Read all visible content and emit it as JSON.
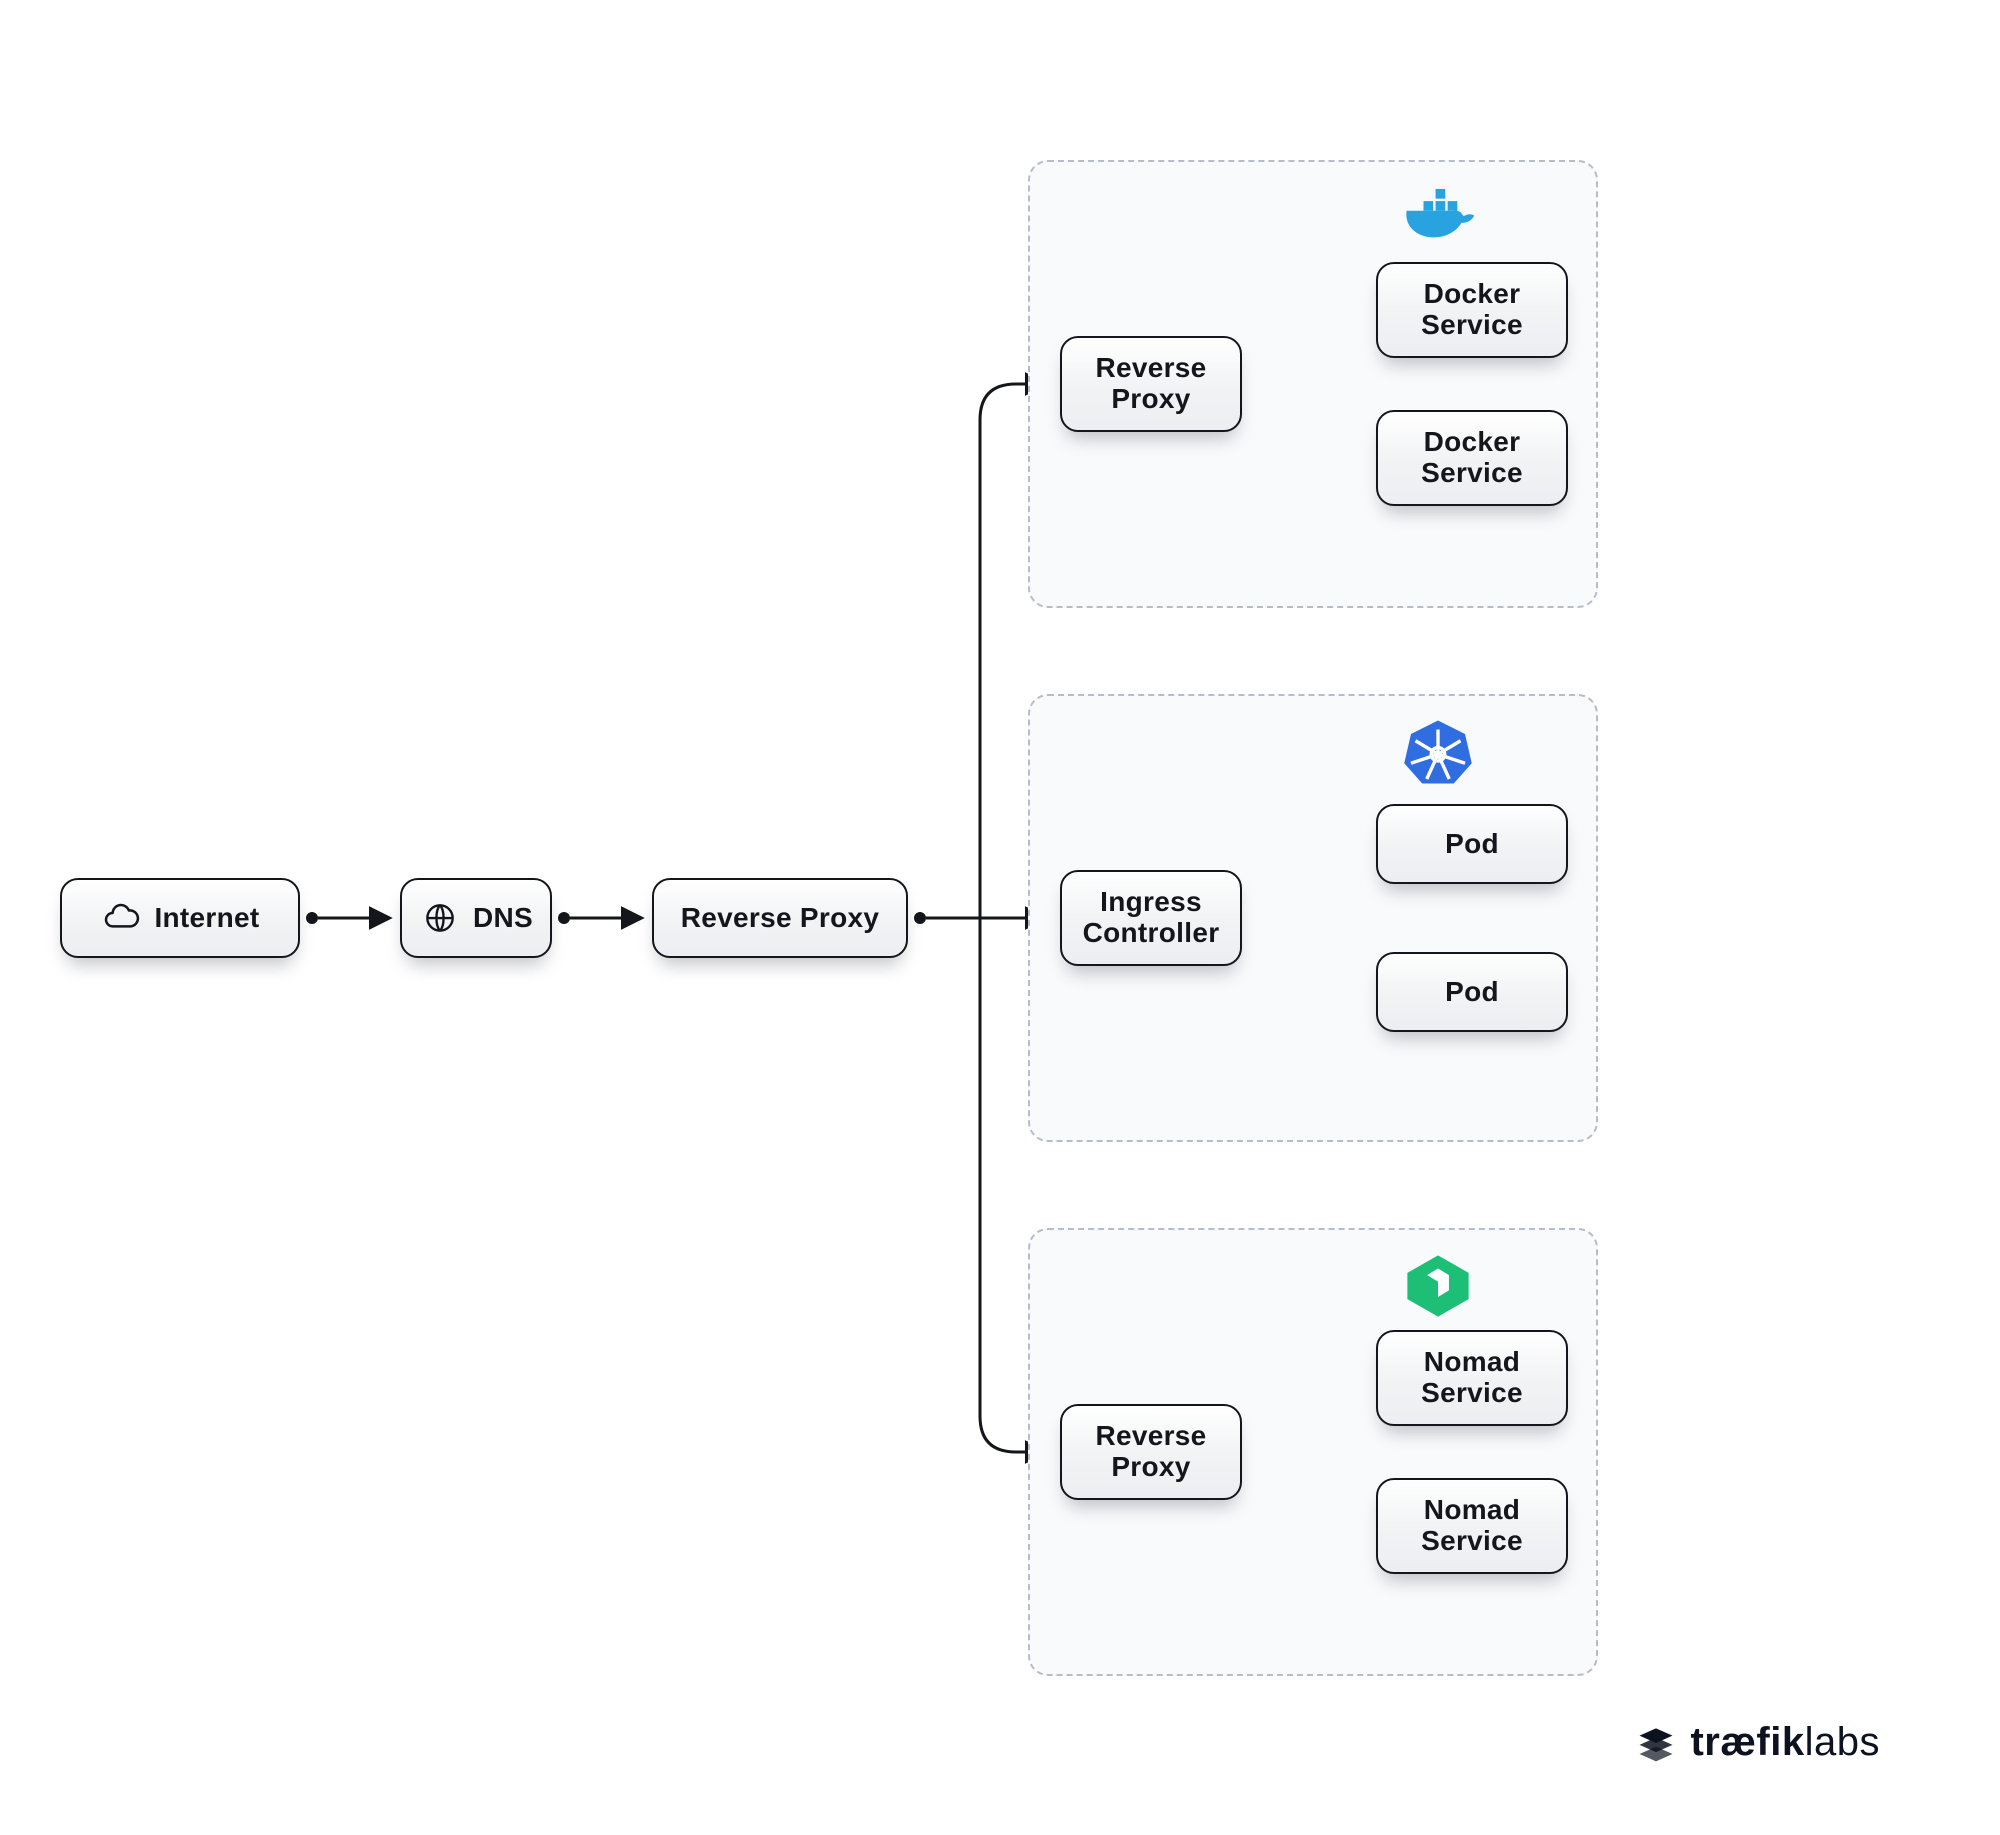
{
  "nodes": {
    "internet": "Internet",
    "dns": "DNS",
    "reverse_proxy_main": "Reverse Proxy",
    "cluster_docker": {
      "proxy": "Reverse\nProxy",
      "svc1": "Docker\nService",
      "svc2": "Docker\nService"
    },
    "cluster_k8s": {
      "proxy": "Ingress\nController",
      "svc1": "Pod",
      "svc2": "Pod"
    },
    "cluster_nomad": {
      "proxy": "Reverse\nProxy",
      "svc1": "Nomad\nService",
      "svc2": "Nomad\nService"
    }
  },
  "icons": {
    "internet": "cloud-icon",
    "dns": "globe-icon",
    "docker": "docker-icon",
    "kubernetes": "kubernetes-icon",
    "nomad": "nomad-icon"
  },
  "brand": {
    "mark": "traefik-mark",
    "name_bold": "træfik",
    "name_light": "labs"
  },
  "colors": {
    "node_border": "#14161c",
    "cluster_border": "#b6bdc9",
    "cluster_bg": "#f9fafc",
    "docker": "#29a3e0",
    "kubernetes": "#2f6de0",
    "nomad": "#1dbf76",
    "brand": "#0c1220"
  }
}
